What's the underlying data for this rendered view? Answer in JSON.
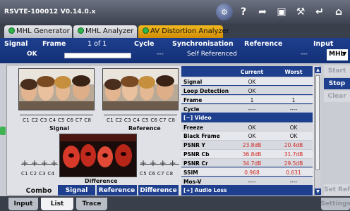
{
  "titlebar": {
    "title": "RSVTE-100012 V0.14.0.x",
    "icons": [
      "globe-icon",
      "help-icon",
      "forward-icon",
      "save-icon",
      "wrench-icon",
      "return-icon",
      "home-icon"
    ]
  },
  "tabs": [
    {
      "label": "MHL Generator",
      "active": false
    },
    {
      "label": "MHL Analyzer",
      "active": false
    },
    {
      "label": "AV Distortion Analyzer",
      "active": true
    }
  ],
  "info": {
    "signal_label": "Signal",
    "signal_value": "OK",
    "frame_label": "Frame",
    "frame_value": "1 of 1",
    "cycle_label": "Cycle",
    "cycle_value": "---",
    "sync_label": "Synchronisation",
    "sync_value": "Self Referenced",
    "reference_label": "Reference",
    "reference_value": "---",
    "input_label": "Input",
    "input_value": "MHL"
  },
  "panels": {
    "channels": "C1 C2 C3 C4 C5 C6 C7 C8",
    "signal_caption": "Signal",
    "reference_caption": "Reference",
    "difference_caption": "Difference",
    "diff_left_channels": "C1 C2 C3 C4",
    "diff_right_channels": "C5 C6 C7 C8"
  },
  "view": {
    "label": "Combo",
    "buttons": [
      "Signal",
      "Reference",
      "Difference"
    ]
  },
  "table": {
    "headers": [
      "",
      "Current",
      "Worst"
    ],
    "rows": [
      {
        "type": "data",
        "name": "Signal",
        "current": "OK",
        "worst": ""
      },
      {
        "type": "data",
        "name": "Loop Detection",
        "current": "OK",
        "worst": ""
      },
      {
        "type": "data",
        "name": "Frame",
        "current": "1",
        "worst": "1"
      },
      {
        "type": "data",
        "name": "Cycle",
        "current": "----",
        "worst": "----"
      },
      {
        "type": "section",
        "name": "[−] Video",
        "current": "",
        "worst": ""
      },
      {
        "type": "data",
        "name": "Freeze",
        "current": "OK",
        "worst": "OK"
      },
      {
        "type": "data",
        "name": "Black Frame",
        "current": "OK",
        "worst": "OK"
      },
      {
        "type": "data",
        "name": "PSNR Y",
        "current": "23.8dB",
        "worst": "20.4dB",
        "red": true
      },
      {
        "type": "data",
        "name": "PSNR Cb",
        "current": "36.8dB",
        "worst": "31.7dB",
        "red": true
      },
      {
        "type": "data",
        "name": "PSNR Cr",
        "current": "34.7dB",
        "worst": "29.5dB",
        "red": true
      },
      {
        "type": "data",
        "name": "SSIM",
        "current": "0.968",
        "worst": "0.631",
        "red": true
      },
      {
        "type": "data",
        "name": "Mos-V",
        "current": "----",
        "worst": "----"
      },
      {
        "type": "section",
        "name": "[+] Audio Loss",
        "current": "",
        "worst": ""
      }
    ]
  },
  "side_buttons": {
    "start": "Start",
    "stop": "Stop",
    "clear": "Clear",
    "set_ref": "Set Ref",
    "settings": "Settings"
  },
  "bottom_tabs": [
    {
      "label": "Input",
      "active": false
    },
    {
      "label": "List",
      "active": true
    },
    {
      "label": "Trace",
      "active": false
    }
  ],
  "colors": {
    "accent_blue": "#1d3f8e",
    "active_tab": "#f0b820",
    "status_green": "#2fb34a",
    "error_red": "#d0281f"
  }
}
